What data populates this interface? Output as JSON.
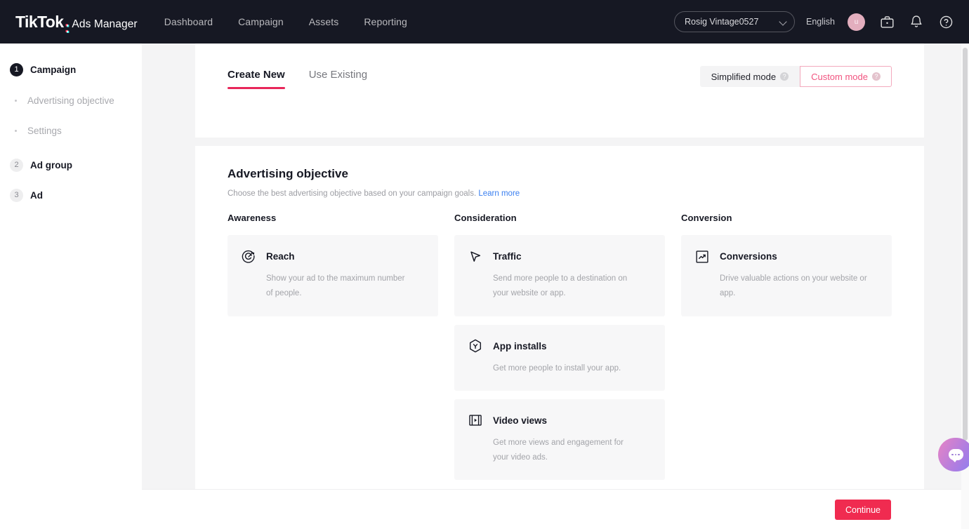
{
  "header": {
    "logo_brand": "TikTok",
    "logo_product": "Ads Manager",
    "nav": [
      {
        "label": "Dashboard"
      },
      {
        "label": "Campaign"
      },
      {
        "label": "Assets"
      },
      {
        "label": "Reporting"
      }
    ],
    "account": {
      "name": "Rosig Vintage0527",
      "chevron_icon": "chevron-down-icon"
    },
    "language": "English",
    "avatar_initial": "u",
    "icons": [
      "briefcase-icon",
      "bell-icon",
      "help-circle-icon"
    ]
  },
  "sidebar": {
    "steps": [
      {
        "num": "1",
        "label": "Campaign",
        "active": true
      },
      {
        "num": "2",
        "label": "Ad group",
        "active": false
      },
      {
        "num": "3",
        "label": "Ad",
        "active": false
      }
    ],
    "substeps": [
      {
        "label": "Advertising objective"
      },
      {
        "label": "Settings"
      }
    ]
  },
  "main": {
    "tabs": [
      {
        "label": "Create New",
        "active": true
      },
      {
        "label": "Use Existing",
        "active": false
      }
    ],
    "modes": [
      {
        "label": "Simplified mode",
        "selected": false,
        "info_icon": "help-circle-icon"
      },
      {
        "label": "Custom mode",
        "selected": true,
        "info_icon": "help-circle-icon"
      }
    ],
    "section": {
      "title": "Advertising objective",
      "subtitle": "Choose the best advertising objective based on your campaign goals.",
      "learn_more": "Learn more"
    },
    "columns": [
      {
        "heading": "Awareness",
        "cards": [
          {
            "title": "Reach",
            "desc": "Show your ad to the maximum number of people.",
            "icon": "target-arrow-icon"
          }
        ]
      },
      {
        "heading": "Consideration",
        "cards": [
          {
            "title": "Traffic",
            "desc": "Send more people to a destination on your website or app.",
            "icon": "cursor-arrow-icon"
          },
          {
            "title": "App installs",
            "desc": "Get more people to install your app.",
            "icon": "hexagon-download-icon"
          },
          {
            "title": "Video views",
            "desc": "Get more views and engagement for your video ads.",
            "icon": "film-play-icon"
          }
        ]
      },
      {
        "heading": "Conversion",
        "cards": [
          {
            "title": "Conversions",
            "desc": "Drive valuable actions on your website or app.",
            "icon": "trending-up-box-icon"
          }
        ]
      }
    ]
  },
  "footer": {
    "continue_label": "Continue"
  },
  "chat": {
    "icon": "chat-bubble-icon"
  },
  "colors": {
    "brand_red": "#FE2C55",
    "brand_cyan": "#25F4EE",
    "accent_pink": "#E8275A",
    "dark_bg": "#161823",
    "page_bg": "#F4F4F5",
    "card_bg": "#F7F7F8",
    "link_blue": "#3A7FF0"
  }
}
